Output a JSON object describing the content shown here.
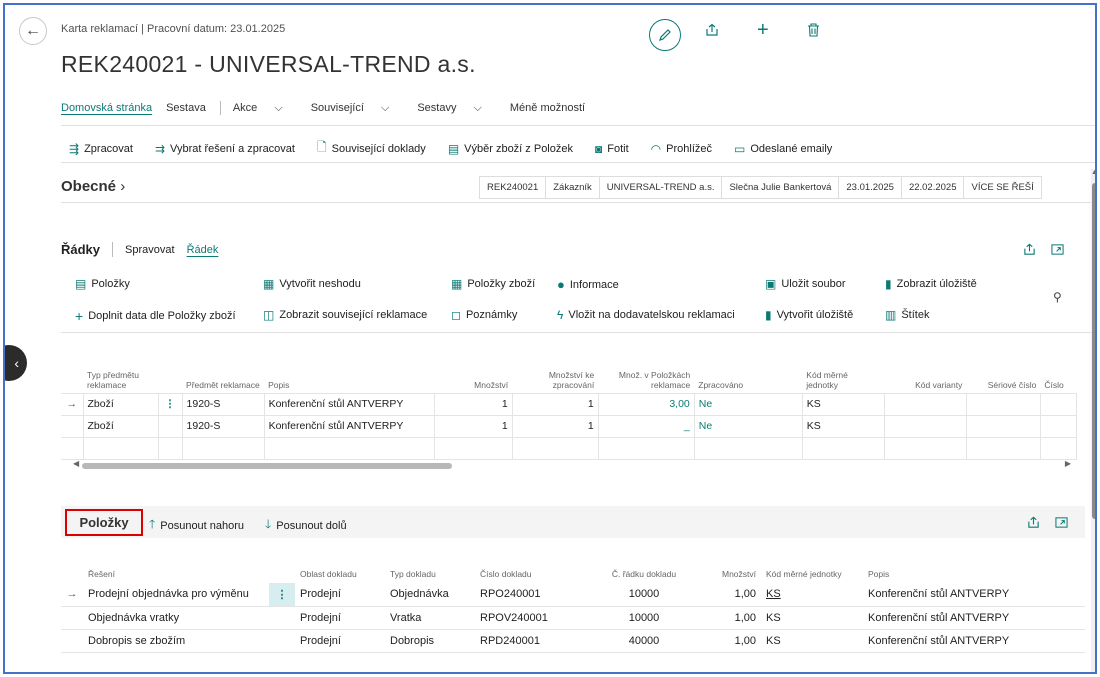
{
  "header": {
    "breadcrumb": "Karta reklamací | Pracovní datum: 23.01.2025",
    "title": "REK240021 - UNIVERSAL-TREND a.s."
  },
  "menu": {
    "items": [
      "Domovská stránka",
      "Sestava",
      "Akce",
      "Související",
      "Sestavy",
      "Méně možností"
    ]
  },
  "actions": {
    "zpracovat": "Zpracovat",
    "vybrat": "Vybrat řešení a zpracovat",
    "souvisejici": "Související doklady",
    "vyber_zbozi": "Výběr zboží z Položek",
    "fotit": "Fotit",
    "prohlizec": "Prohlížeč",
    "emaily": "Odeslané emaily"
  },
  "obecne": {
    "label": "Obecné",
    "summary": [
      "REK240021",
      "Zákazník",
      "UNIVERSAL-TREND a.s.",
      "Slečna Julie Bankertová",
      "23.01.2025",
      "22.02.2025",
      "VÍCE SE ŘEŠÍ"
    ]
  },
  "radky": {
    "title": "Řádky",
    "tab_spravovat": "Spravovat",
    "tab_radek": "Řádek",
    "btn_polozky": "Položky",
    "btn_vytvorit_neshodu": "Vytvořit neshodu",
    "btn_polozky_zbozi": "Položky zboží",
    "btn_informace": "Informace",
    "btn_ulozit_soubor": "Uložit soubor",
    "btn_zobrazit_uloziste": "Zobrazit úložiště",
    "btn_doplnit": "Doplnit data dle Položky zboží",
    "btn_zobrazit_souv": "Zobrazit související reklamace",
    "btn_poznamky": "Poznámky",
    "btn_vlozit": "Vložit na dodavatelskou reklamaci",
    "btn_vytvorit_uloziste": "Vytvořit úložiště",
    "btn_stitek": "Štítek",
    "columns": {
      "typ": "Typ předmětu reklamace",
      "predmet": "Předmět reklamace",
      "popis": "Popis",
      "mnozstvi": "Množství",
      "ke_zprac": "Množství ke zpracování",
      "v_polozkach": "Množ. v Položkách reklamace",
      "zpracovano": "Zpracováno",
      "kod_mj": "Kód měrné jednotky",
      "kod_var": "Kód varianty",
      "seriove": "Sériové číslo",
      "cislo": "Číslo"
    },
    "rows": [
      {
        "typ": "Zboží",
        "predmet": "1920-S",
        "popis": "Konferenční stůl ANTVERPY",
        "mnozstvi": "1",
        "ke_zprac": "1",
        "v_polozkach": "3,00",
        "zpracovano": "Ne",
        "kod_mj": "KS"
      },
      {
        "typ": "Zboží",
        "predmet": "1920-S",
        "popis": "Konferenční stůl ANTVERPY",
        "mnozstvi": "1",
        "ke_zprac": "1",
        "v_polozkach": "_",
        "zpracovano": "Ne",
        "kod_mj": "KS"
      }
    ]
  },
  "polozky": {
    "title": "Položky",
    "btn_nahoru": "Posunout nahoru",
    "btn_dolu": "Posunout dolů",
    "columns": {
      "reseni": "Řešení",
      "oblast": "Oblast dokladu",
      "typ": "Typ dokladu",
      "cislo": "Číslo dokladu",
      "radek": "Č. řádku dokladu",
      "mnozstvi": "Množství",
      "kod_mj": "Kód měrné jednotky",
      "popis": "Popis"
    },
    "rows": [
      {
        "reseni": "Prodejní objednávka pro výměnu",
        "oblast": "Prodejní",
        "typ": "Objednávka",
        "cislo": "RPO240001",
        "radek": "10000",
        "mnozstvi": "1,00",
        "kod_mj": "KS",
        "popis": "Konferenční stůl ANTVERPY"
      },
      {
        "reseni": "Objednávka vratky",
        "oblast": "Prodejní",
        "typ": "Vratka",
        "cislo": "RPOV240001",
        "radek": "10000",
        "mnozstvi": "1,00",
        "kod_mj": "KS",
        "popis": "Konferenční stůl ANTVERPY"
      },
      {
        "reseni": "Dobropis se zbožím",
        "oblast": "Prodejní",
        "typ": "Dobropis",
        "cislo": "RPD240001",
        "radek": "40000",
        "mnozstvi": "1,00",
        "kod_mj": "KS",
        "popis": "Konferenční stůl ANTVERPY"
      }
    ]
  },
  "colors": {
    "accent": "#0b7a75",
    "highlight": "#d00000",
    "frame": "#4472c4"
  }
}
